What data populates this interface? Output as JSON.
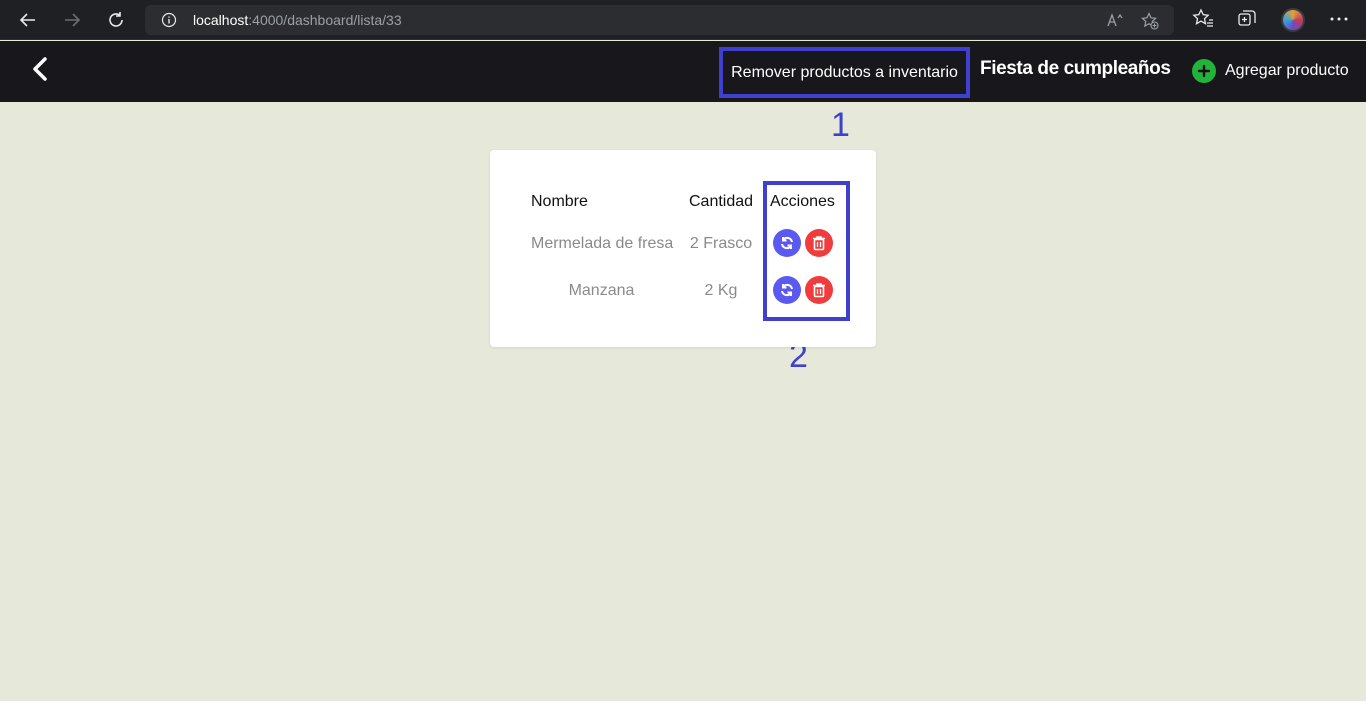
{
  "browser": {
    "url_host": "localhost",
    "url_path": ":4000/dashboard/lista/33"
  },
  "header": {
    "remove_label": "Remover productos a inventario",
    "title": "Fiesta de cumpleaños",
    "add_label": "Agregar producto"
  },
  "annotations": [
    "1",
    "2"
  ],
  "table": {
    "headers": [
      "Nombre",
      "Cantidad",
      "Acciones"
    ],
    "rows": [
      {
        "name": "Mermelada de fresa",
        "qty": "2 Frasco"
      },
      {
        "name": "Manzana",
        "qty": "2 Kg"
      }
    ]
  },
  "colors": {
    "annotation": "#3f3fd0",
    "refresh": "#5a5af0",
    "delete": "#f03c3c",
    "add": "#22b33a",
    "background": "#e6e9d9"
  }
}
